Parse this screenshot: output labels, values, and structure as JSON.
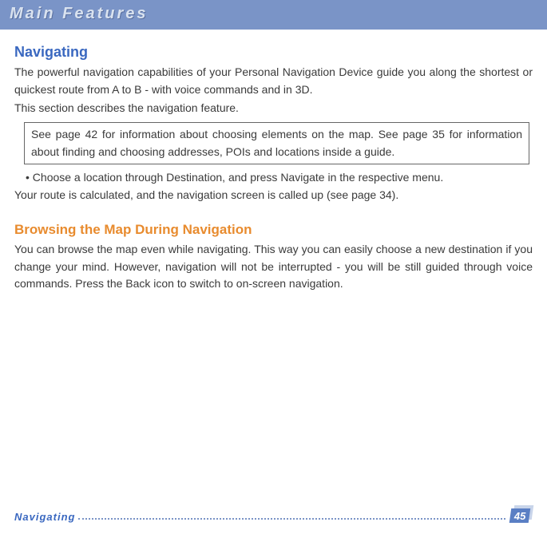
{
  "header": {
    "title": "Main Features"
  },
  "section1": {
    "title": "Navigating",
    "p1": "The powerful navigation capabilities of your Personal Navigation Device guide you along the shortest or quickest route from A to B - with voice commands and in 3D.",
    "p2": "This section describes the navigation feature.",
    "note": "See page 42 for information about choosing elements on the map. See page 35 for information about finding and choosing addresses, POIs and locations inside a guide.",
    "bullet": "• Choose a location through Destination, and press Navigate in the respective menu.",
    "p3": "Your route is calculated, and the navigation screen is called up (see page 34)."
  },
  "section2": {
    "title": "Browsing the Map During Navigation",
    "p1": "You can browse the map even while navigating. This way you can easily choose a new destination if you change your mind. However, navigation will not be interrupted - you will be still guided through voice commands. Press the Back icon to switch to on-screen navigation."
  },
  "footer": {
    "label": "Navigating",
    "page": "45"
  }
}
